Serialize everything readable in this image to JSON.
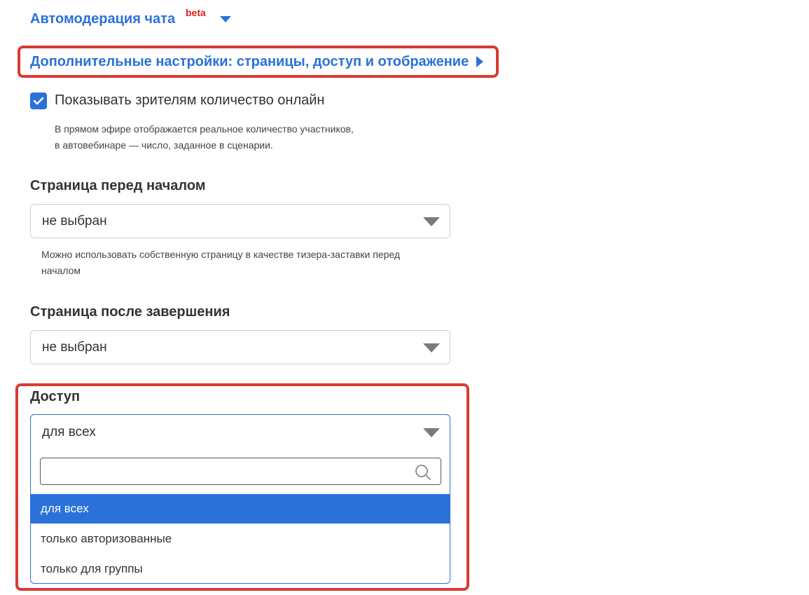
{
  "chat_automoderation": {
    "label": "Автомодерация чата",
    "badge": "beta"
  },
  "additional_settings": {
    "label": "Дополнительные настройки: страницы, доступ и отображение"
  },
  "show_online": {
    "checked": true,
    "label": "Показывать зрителям количество онлайн",
    "hint_line1": "В прямом эфире отображается реальное количество участников,",
    "hint_line2": "в автовебинаре — число, заданное в сценарии."
  },
  "page_before": {
    "label": "Страница перед началом",
    "value": "не выбран",
    "hint_line1": "Можно использовать собственную страницу в качестве тизера-заставки перед",
    "hint_line2": "началом"
  },
  "page_after": {
    "label": "Страница после завершения",
    "value": "не выбран"
  },
  "access": {
    "label": "Доступ",
    "value": "для всех",
    "search_placeholder": "",
    "options": [
      {
        "label": "для всех",
        "selected": true
      },
      {
        "label": "только авторизованные",
        "selected": false
      },
      {
        "label": "только для группы",
        "selected": false
      }
    ]
  },
  "colors": {
    "accent": "#2a72d9",
    "highlight": "#d93a34",
    "beta": "#e11d1d"
  }
}
